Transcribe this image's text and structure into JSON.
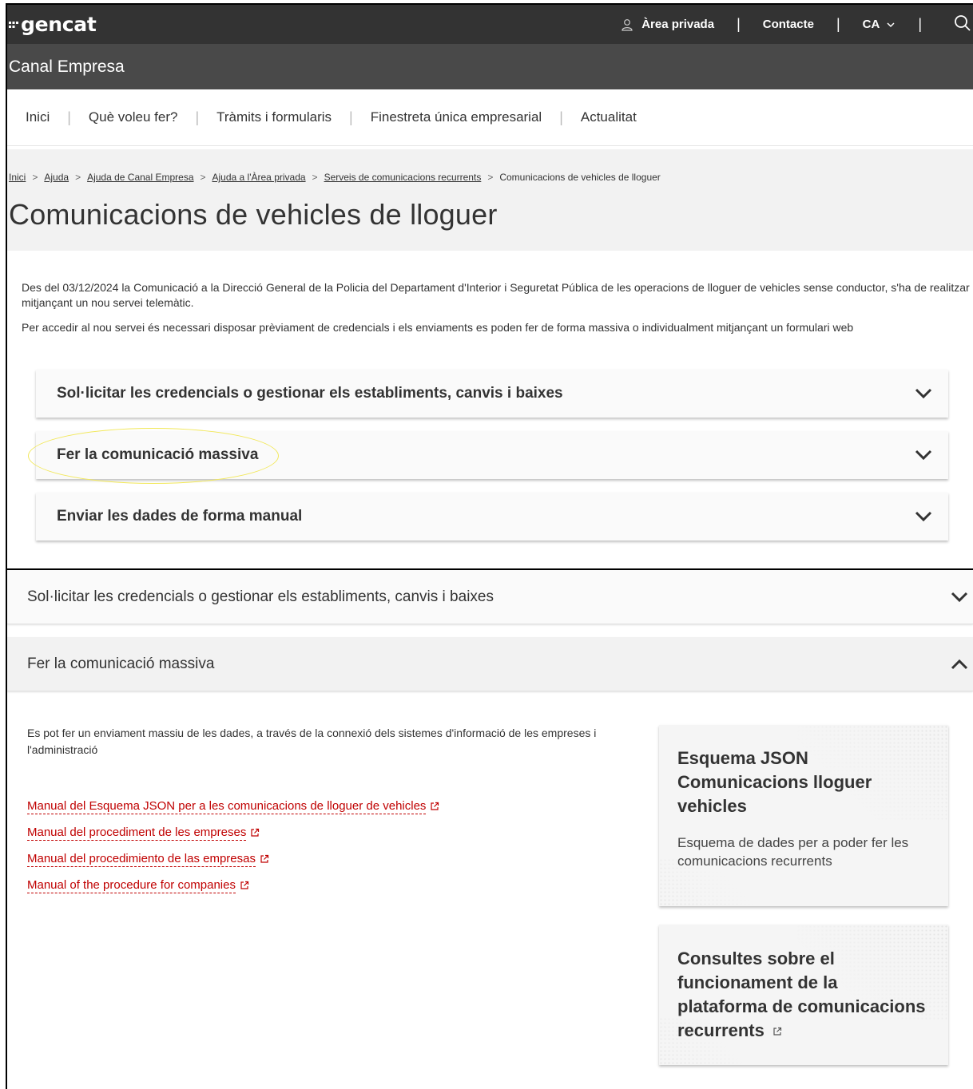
{
  "header": {
    "logo": "gencat",
    "private_area": "Àrea privada",
    "contact": "Contacte",
    "language": "CA",
    "separator": "|"
  },
  "brand": "Canal Empresa",
  "main_nav": {
    "items": [
      {
        "label": "Inici"
      },
      {
        "label": "Què voleu fer?"
      },
      {
        "label": "Tràmits i formularis"
      },
      {
        "label": "Finestreta única empresarial"
      },
      {
        "label": "Actualitat"
      }
    ]
  },
  "breadcrumb": {
    "items": [
      {
        "label": "Inici"
      },
      {
        "label": "Ajuda"
      },
      {
        "label": "Ajuda de Canal Empresa"
      },
      {
        "label": "Ajuda a l'Àrea privada"
      },
      {
        "label": "Serveis de comunicacions recurrents"
      }
    ],
    "current": "Comunicacions de vehicles de lloguer",
    "separator": ">"
  },
  "page_title": "Comunicacions de vehicles de lloguer",
  "intro": {
    "p1": "Des del 03/12/2024 la Comunicació a la Direcció General de la Policia del Departament d'Interior i Seguretat Pública de les operacions de lloguer de vehicles sense conductor, s'ha de realitzar mitjançant un nou servei telemàtic.",
    "p2": "Per accedir al nou servei és necessari disposar prèviament de credencials i els enviaments es poden fer de forma massiva o individualment mitjançant un formulari web"
  },
  "accordion": {
    "items": [
      {
        "label": "Sol·licitar les credencials o gestionar els establiments, canvis i baixes"
      },
      {
        "label": "Fer la comunicació massiva"
      },
      {
        "label": "Enviar les dades de forma manual"
      }
    ]
  },
  "expanded": {
    "first_label": "Sol·licitar les credencials o gestionar els establiments, canvis i baixes",
    "open_label": "Fer la comunicació massiva",
    "description": "Es pot fer un enviament massiu de les dades, a través de la connexió dels sistemes d'informació de les empreses i l'administració",
    "links": [
      {
        "label": "Manual del Esquema JSON per a les comunicacions de lloguer de vehicles"
      },
      {
        "label": "Manual del procediment de les empreses"
      },
      {
        "label": "Manual del procedimiento de las empresas"
      },
      {
        "label": "Manual of the procedure for companies"
      }
    ],
    "cards": [
      {
        "title": "Esquema JSON Comunicacions lloguer vehicles",
        "text": "Esquema de dades per a poder fer les comunicacions recurrents"
      },
      {
        "title": "Consultes sobre el funcionament de la plataforma de comunicacions recurrents"
      }
    ]
  },
  "colors": {
    "topbar": "#333333",
    "brandbar": "#494949",
    "link_red": "#c00000",
    "highlight": "#f2e85a"
  }
}
